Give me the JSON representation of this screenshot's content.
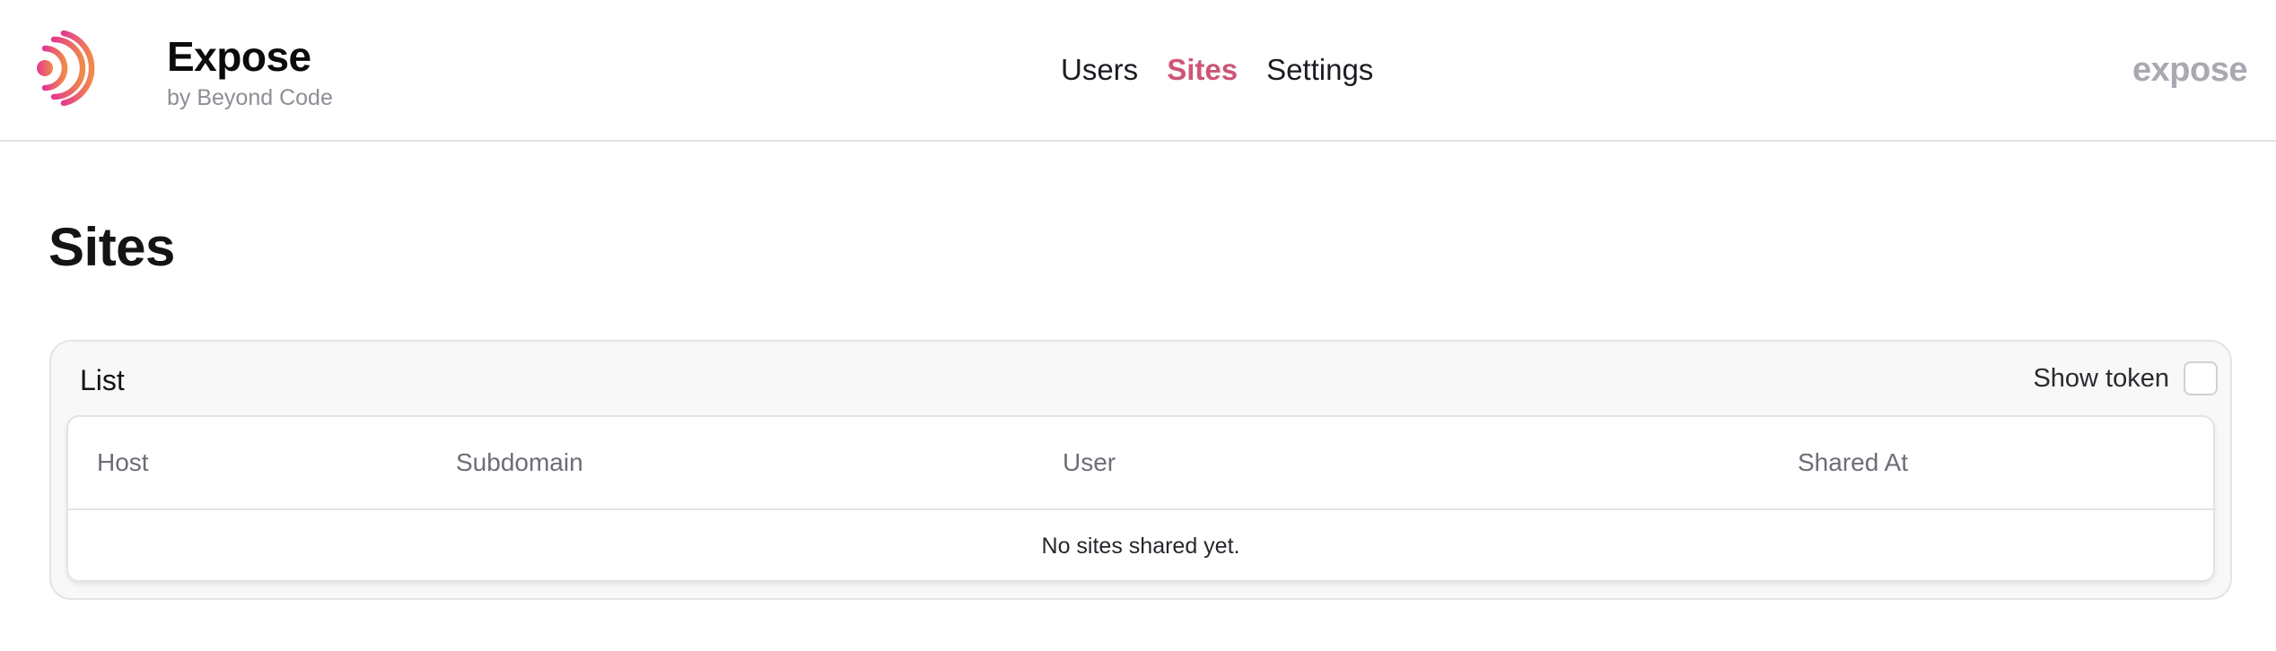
{
  "brand": {
    "name": "Expose",
    "subtitle": "by Beyond Code",
    "icon": "expose-waves-logo"
  },
  "nav": {
    "items": [
      {
        "label": "Users",
        "active": false
      },
      {
        "label": "Sites",
        "active": true
      },
      {
        "label": "Settings",
        "active": false
      }
    ]
  },
  "corner_logo": "expose",
  "page": {
    "title": "Sites"
  },
  "panel": {
    "title": "List",
    "toggle_label": "Show token",
    "toggle_checked": false
  },
  "table": {
    "columns": [
      "Host",
      "Subdomain",
      "User",
      "Shared At"
    ],
    "rows": [],
    "empty_message": "No sites shared yet."
  },
  "colors": {
    "accent": "#cc5678",
    "logo_gradient_start": "#e43a8f",
    "logo_gradient_end": "#f08a4b",
    "muted_text": "#8e8e96",
    "corner_logo": "#a9a9b1"
  }
}
